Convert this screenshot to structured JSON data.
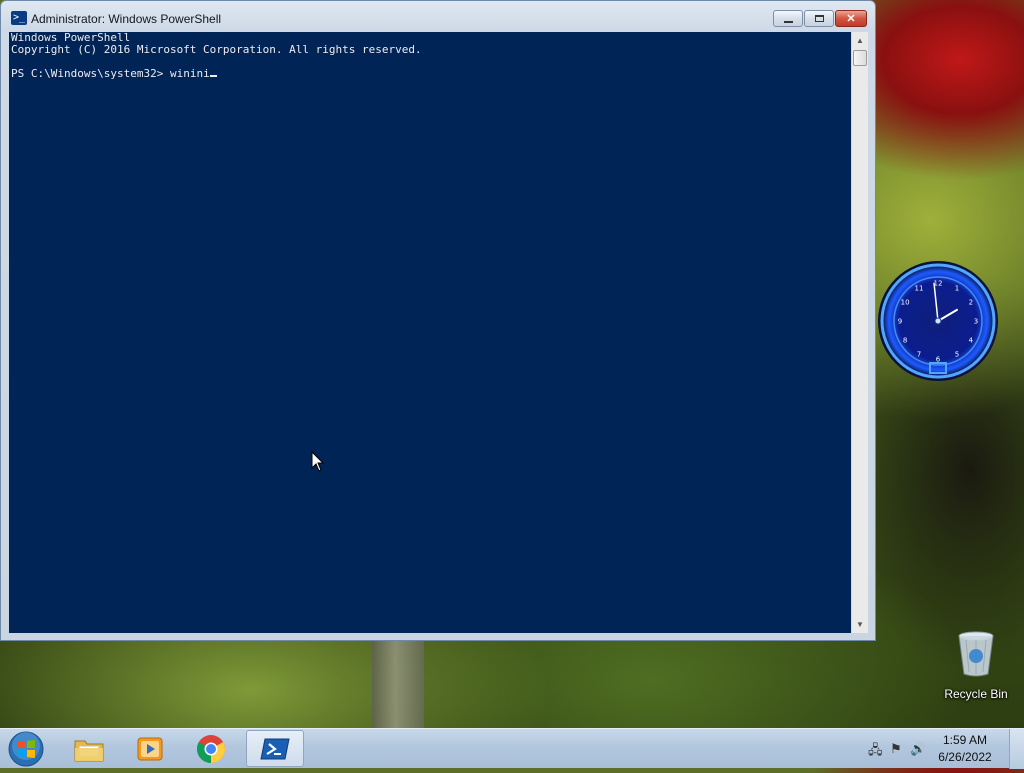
{
  "window": {
    "title": "Administrator: Windows PowerShell",
    "icon": "powershell-icon"
  },
  "console": {
    "lines": [
      "Windows PowerShell",
      "Copyright (C) 2016 Microsoft Corporation. All rights reserved.",
      ""
    ],
    "prompt": "PS C:\\Windows\\system32> ",
    "input": "winini",
    "background": "#012456",
    "foreground": "#eeedf0"
  },
  "desktop": {
    "recycle_bin_label": "Recycle Bin"
  },
  "taskbar": {
    "items": [
      {
        "name": "windows-explorer",
        "icon": "folder-icon"
      },
      {
        "name": "windows-media-player",
        "icon": "media-player-icon"
      },
      {
        "name": "google-chrome",
        "icon": "chrome-icon"
      },
      {
        "name": "windows-powershell",
        "icon": "powershell-icon",
        "active": true
      }
    ],
    "clock": {
      "time": "1:59 AM",
      "date": "6/26/2022"
    }
  },
  "gadget_clock": {
    "numerals": [
      "12",
      "1",
      "2",
      "3",
      "4",
      "5",
      "6",
      "7",
      "8",
      "9",
      "10",
      "11"
    ],
    "hour": 1,
    "minute": 59
  }
}
